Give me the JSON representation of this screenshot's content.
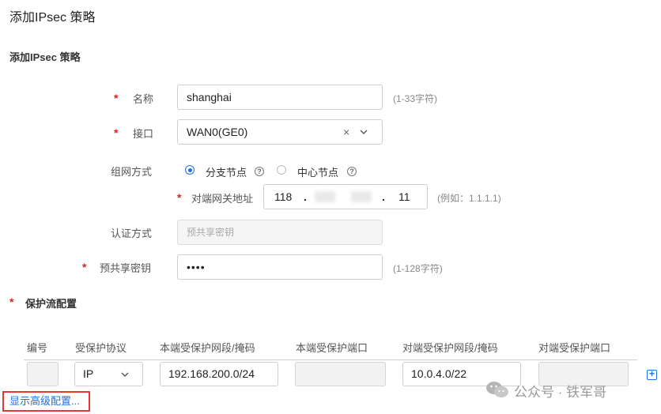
{
  "page": {
    "title": "添加IPsec 策略"
  },
  "section": {
    "title": "添加IPsec 策略"
  },
  "form": {
    "name": {
      "label": "名称",
      "value": "shanghai",
      "hint": "(1-33字符)"
    },
    "interface": {
      "label": "接口",
      "value": "WAN0(GE0)",
      "clear_glyph": "×",
      "arrow_glyph": "⌄"
    },
    "network_mode": {
      "label": "组网方式",
      "options": [
        {
          "label": "分支节点",
          "checked": true
        },
        {
          "label": "中心节点",
          "checked": false
        }
      ]
    },
    "peer_gateway": {
      "label": "对端网关地址",
      "octet1": "118",
      "octet4": "11",
      "dot": ".",
      "hint": "(例如：1.1.1.1)"
    },
    "auth_method": {
      "label": "认证方式",
      "value": "预共享密钥"
    },
    "psk": {
      "label": "预共享密钥",
      "value": "••••",
      "hint": "(1-128字符)"
    }
  },
  "flow": {
    "title": "保护流配置",
    "columns": [
      "编号",
      "受保护协议",
      "本端受保护网段/掩码",
      "本端受保护端口",
      "对端受保护网段/掩码",
      "对端受保护端口"
    ],
    "row": {
      "number": "",
      "protocol": "IP",
      "local_subnet": "192.168.200.0/24",
      "local_port": "",
      "peer_subnet": "10.0.4.0/22",
      "peer_port": ""
    },
    "add_glyph": "+"
  },
  "advanced_link": "显示高级配置...",
  "watermark": "公众号 · 铁军哥",
  "help_glyph": "?",
  "required_mark": "*",
  "colors": {
    "accent": "#1f6fe5",
    "required": "#e02020",
    "highlight_box": "#e53935"
  },
  "icons": {
    "help": "question-circle-icon",
    "add": "plus-square-icon",
    "clear": "close-icon",
    "dropdown": "chevron-down-icon",
    "wechat": "wechat-icon"
  }
}
